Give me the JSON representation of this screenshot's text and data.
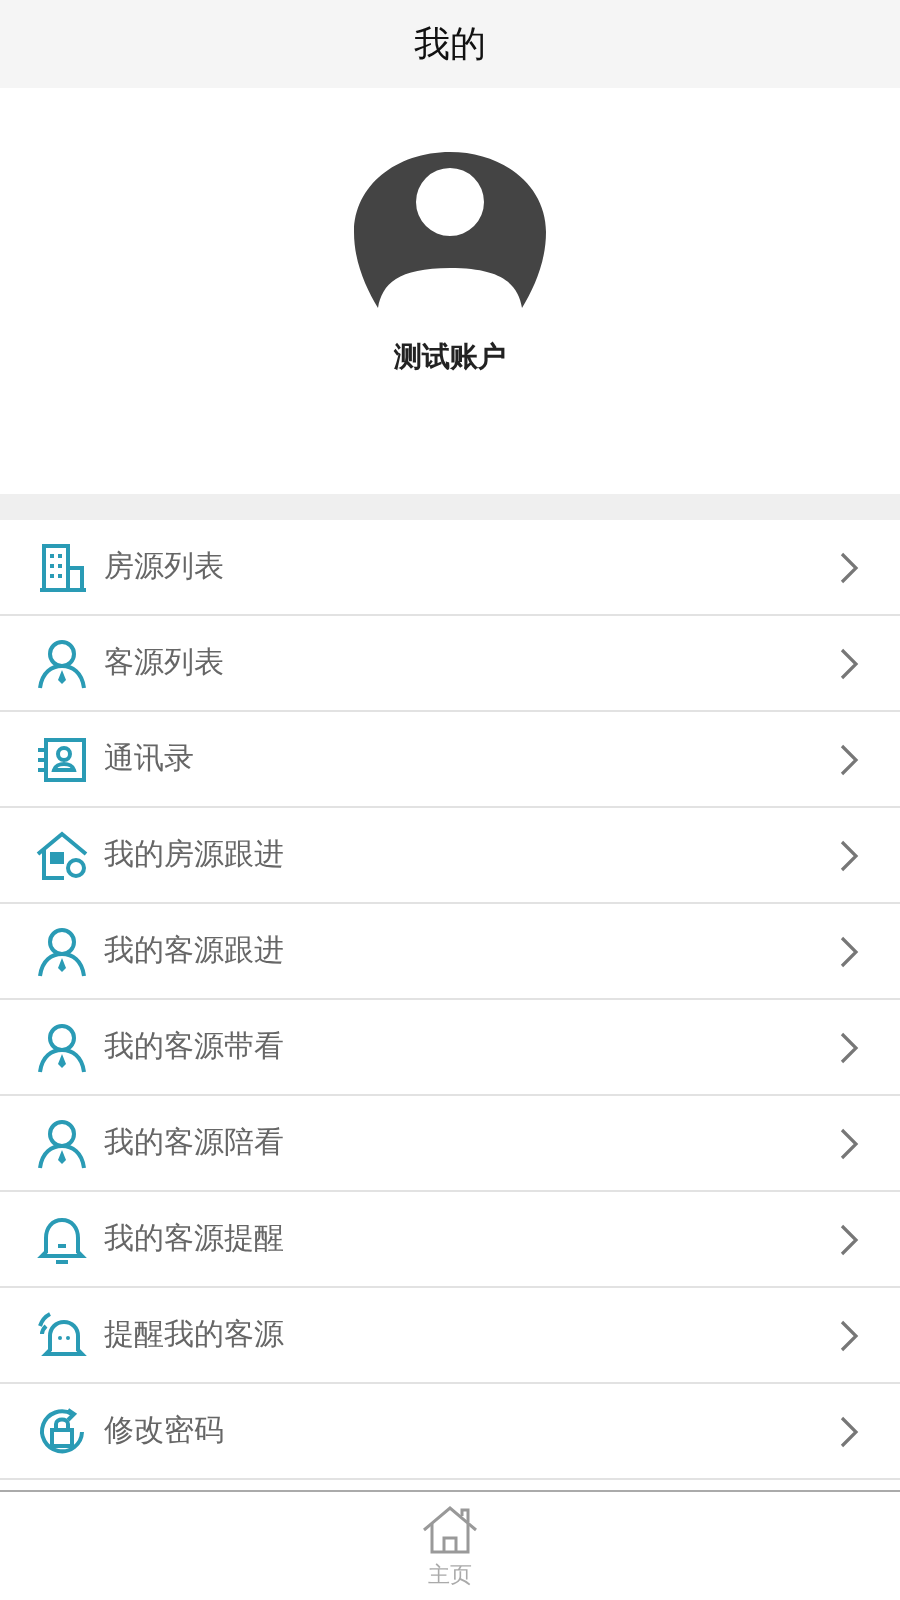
{
  "header": {
    "title": "我的"
  },
  "profile": {
    "name": "测试账户"
  },
  "menu": [
    {
      "kind": "building",
      "label": "房源列表"
    },
    {
      "kind": "person",
      "label": "客源列表"
    },
    {
      "kind": "contacts",
      "label": "通讯录"
    },
    {
      "kind": "house",
      "label": "我的房源跟进"
    },
    {
      "kind": "person",
      "label": "我的客源跟进"
    },
    {
      "kind": "person",
      "label": "我的客源带看"
    },
    {
      "kind": "person",
      "label": "我的客源陪看"
    },
    {
      "kind": "bell",
      "label": "我的客源提醒"
    },
    {
      "kind": "ringing",
      "label": "提醒我的客源"
    },
    {
      "kind": "lock",
      "label": "修改密码"
    }
  ],
  "tab_bar": [
    {
      "label": "主页",
      "selected": false
    }
  ]
}
